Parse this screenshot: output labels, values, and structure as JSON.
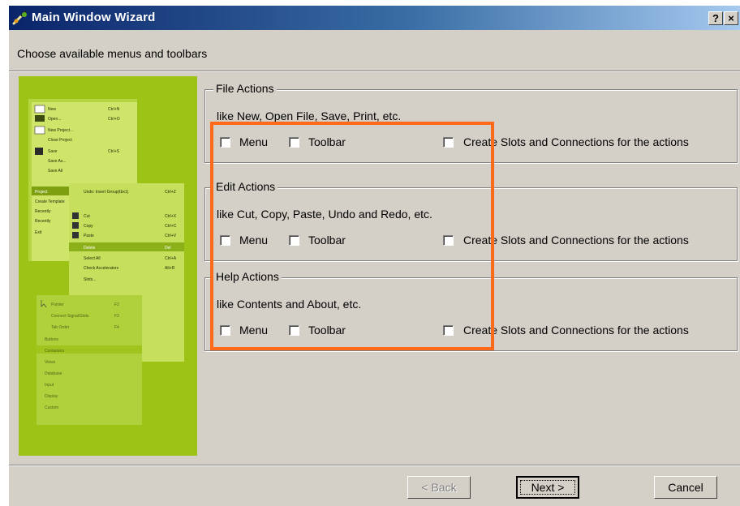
{
  "window": {
    "title": "Main Window Wizard",
    "help_label": "?",
    "close_label": "×",
    "icon": "wand-icon"
  },
  "subtitle": "Choose available menus and toolbars",
  "groups": [
    {
      "title": "File Actions",
      "description": "like New, Open File, Save, Print, etc.",
      "menu_label": "Menu",
      "toolbar_label": "Toolbar",
      "slots_label": "Create Slots and Connections for the actions"
    },
    {
      "title": "Edit Actions",
      "description": "like Cut, Copy, Paste, Undo and Redo, etc.",
      "menu_label": "Menu",
      "toolbar_label": "Toolbar",
      "slots_label": "Create Slots and Connections for the actions"
    },
    {
      "title": "Help Actions",
      "description": "like Contents and About, etc.",
      "menu_label": "Menu",
      "toolbar_label": "Toolbar",
      "slots_label": "Create Slots and Connections for the actions"
    }
  ],
  "illustration": {
    "menu_items": [
      "New",
      "Open...",
      "New Project...",
      "Close Project",
      "Save",
      "Save As...",
      "Save All",
      "Create Template",
      "Recently",
      "Recently",
      "Exit"
    ],
    "shortcuts": [
      "Ctrl+N",
      "Ctrl+O",
      "Ctrl+S"
    ],
    "edit_items": [
      "Undo: Insert Group(tbx1)",
      "Cut",
      "Copy",
      "Paste",
      "Delete",
      "Select All",
      "Check Accelerators",
      "Slots..."
    ],
    "edit_shortcuts": [
      "Ctrl+Z",
      "Ctrl+X",
      "Ctrl+C",
      "Ctrl+V",
      "Del",
      "Ctrl+A",
      "Alt+R"
    ],
    "tool_items": [
      "Pointer",
      "Connect Signal/Slots",
      "Tab Order",
      "Buttons",
      "Containers",
      "Views",
      "Database",
      "Input",
      "Display",
      "Custom"
    ],
    "tool_shortcuts": [
      "F2",
      "F3",
      "F4"
    ]
  },
  "buttons": {
    "back": "< Back",
    "next": "Next >",
    "cancel": "Cancel"
  },
  "colors": {
    "highlight": "#ff6a1a",
    "illustration_bg": "#9ec317",
    "titlebar": "#0a246a"
  }
}
